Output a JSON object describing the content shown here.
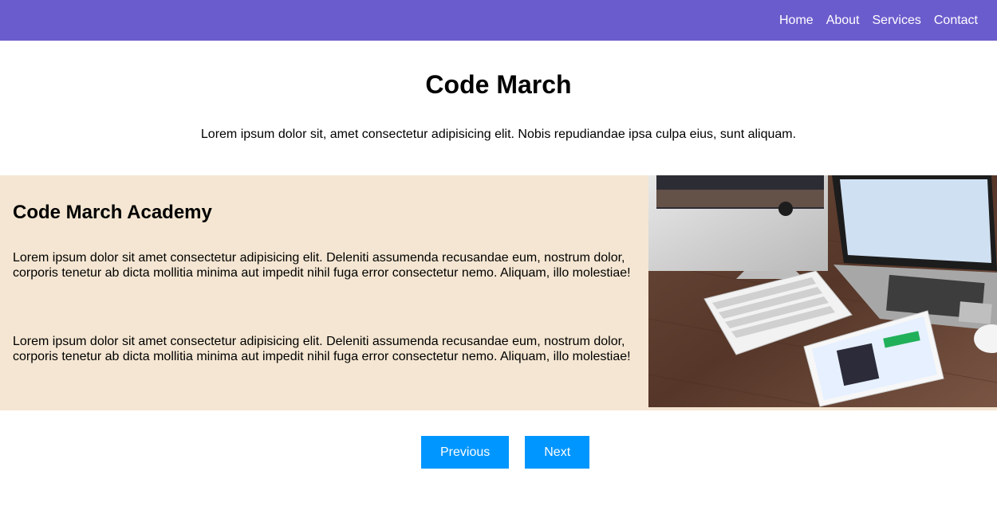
{
  "nav": {
    "links": [
      "Home",
      "About",
      "Services",
      "Contact"
    ]
  },
  "hero": {
    "title": "Code March",
    "text": "Lorem ipsum dolor sit, amet consectetur adipisicing elit. Nobis repudiandae ipsa culpa eius, sunt aliquam."
  },
  "feature": {
    "title": "Code March Academy",
    "paragraphs": [
      "Lorem ipsum dolor sit amet consectetur adipisicing elit. Deleniti assumenda recusandae eum, nostrum dolor, corporis tenetur ab dicta mollitia minima aut impedit nihil fuga error consectetur nemo. Aliquam, illo molestiae!",
      "Lorem ipsum dolor sit amet consectetur adipisicing elit. Deleniti assumenda recusandae eum, nostrum dolor, corporis tenetur ab dicta mollitia minima aut impedit nihil fuga error consectetur nemo. Aliquam, illo molestiae!"
    ]
  },
  "pagination": {
    "previous_label": "Previous",
    "next_label": "Next"
  },
  "colors": {
    "navbar": "#6b5ccd",
    "feature_bg": "#f4e6d2",
    "button": "#0096ff"
  }
}
